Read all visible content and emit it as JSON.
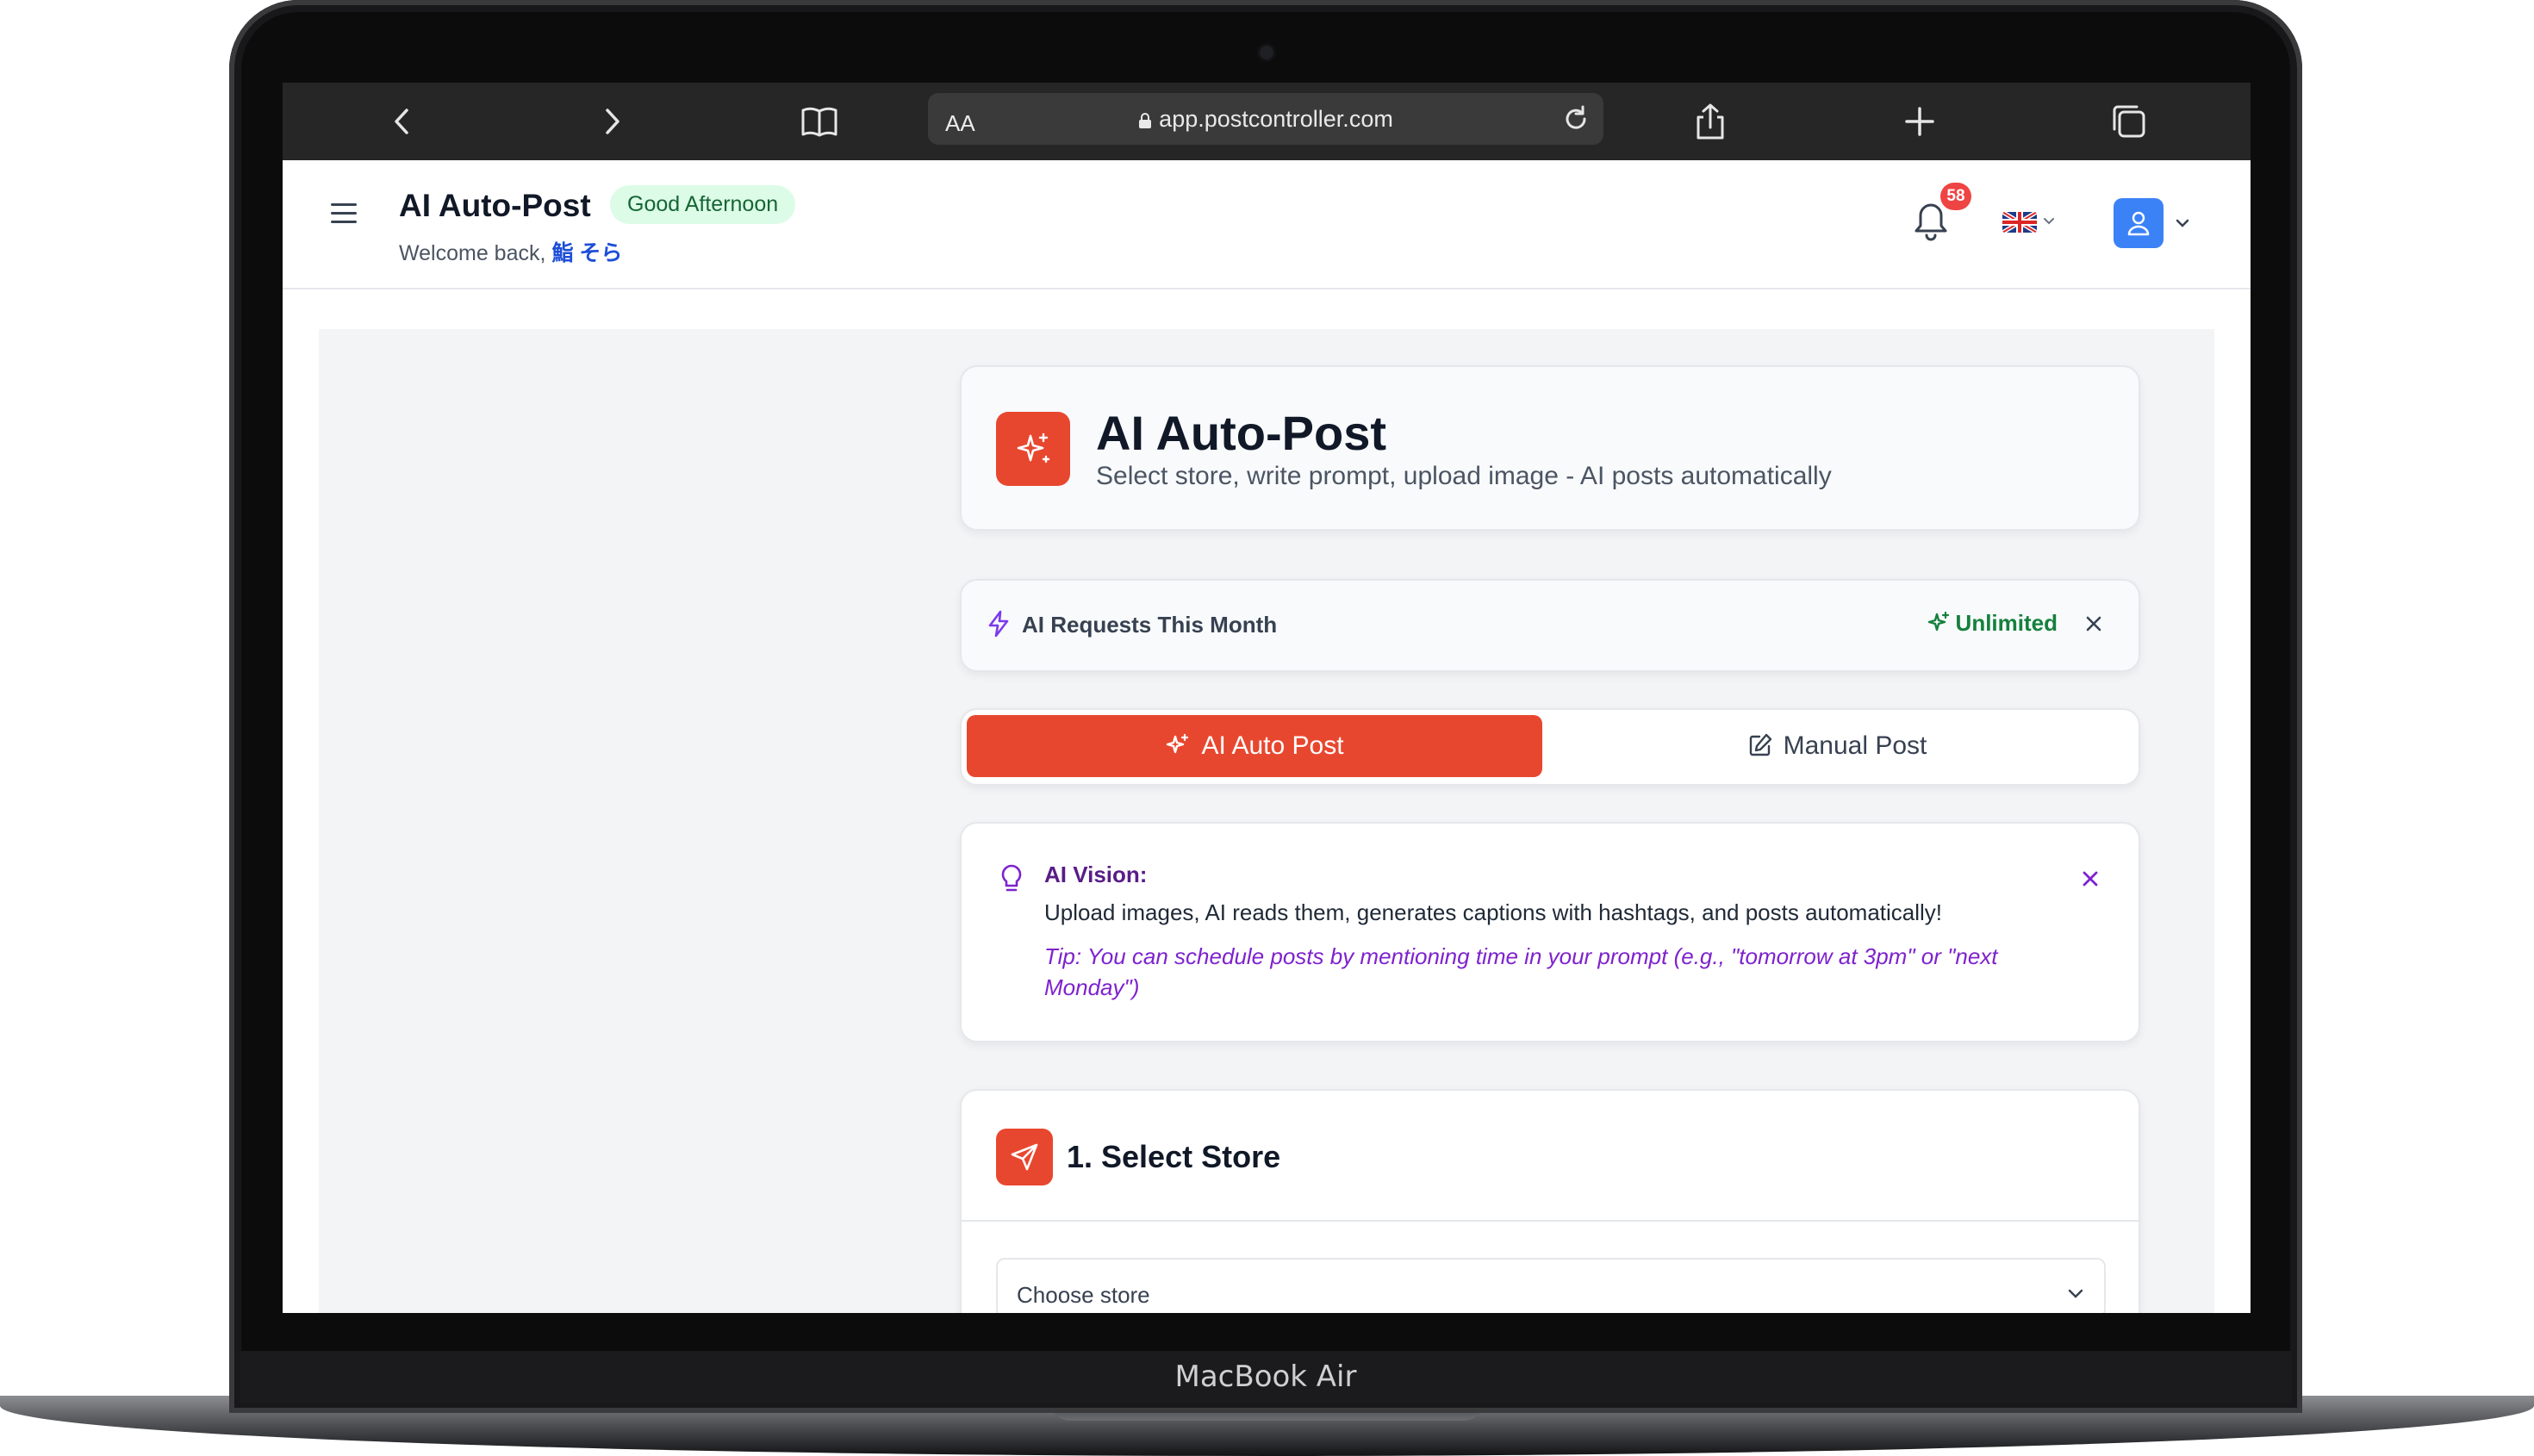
{
  "device": {
    "label": "MacBook Air"
  },
  "browser": {
    "text_size_button": "AA",
    "url": "app.postcontroller.com"
  },
  "header": {
    "title": "AI Auto-Post",
    "greeting": "Good Afternoon",
    "welcome_prefix": "Welcome back,",
    "username": "鮨 そら",
    "notification_count": "58",
    "language": "English (UK flag)"
  },
  "hero": {
    "title": "AI Auto-Post",
    "subtitle": "Select store, write prompt, upload image - AI posts automatically"
  },
  "usage": {
    "label": "AI Requests This Month",
    "status": "Unlimited"
  },
  "tabs": [
    {
      "label": "AI Auto Post",
      "active": true
    },
    {
      "label": "Manual Post",
      "active": false
    }
  ],
  "vision": {
    "title": "AI Vision:",
    "text": "Upload images, AI reads them, generates captions with hashtags, and posts automatically!",
    "tip": "Tip: You can schedule posts by mentioning time in your prompt (e.g., \"tomorrow at 3pm\" or \"next Monday\")"
  },
  "store": {
    "title": "1. Select Store",
    "select_value": "Choose store"
  },
  "colors": {
    "accent": "#e8472f",
    "success": "#15803d",
    "vision_purple": "#7e22ce",
    "avatar_blue": "#3b82f6"
  }
}
